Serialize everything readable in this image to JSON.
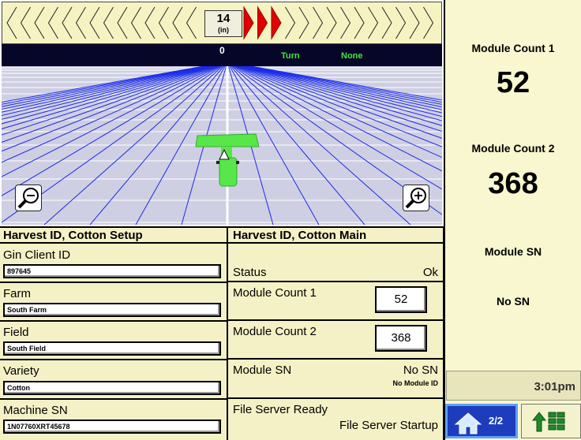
{
  "guidance": {
    "offset_value": "14",
    "offset_unit": "(in)",
    "cross_track": "0",
    "turn_label": "Turn",
    "turn_value": "None",
    "zoom_out_icon": "zoom-out-icon",
    "zoom_in_icon": "zoom-in-icon"
  },
  "right_panel": {
    "module_count_1_label": "Module Count 1",
    "module_count_1_value": "52",
    "module_count_2_label": "Module Count 2",
    "module_count_2_value": "368",
    "module_sn_label": "Module SN",
    "module_sn_value": "No SN",
    "time": "3:01pm",
    "page_indicator": "2/2",
    "home_icon": "home-icon",
    "menu_icon": "menu-grid-icon"
  },
  "setup_panel": {
    "title": "Harvest ID, Cotton Setup",
    "fields": [
      {
        "label": "Gin Client ID",
        "value": "897645"
      },
      {
        "label": "Farm",
        "value": "South Farm"
      },
      {
        "label": "Field",
        "value": "South Field"
      },
      {
        "label": "Variety",
        "value": "Cotton"
      },
      {
        "label": "Machine SN",
        "value": "1N07760XRT45678"
      }
    ]
  },
  "main_panel": {
    "title": "Harvest ID, Cotton Main",
    "status_label": "Status",
    "status_value": "Ok",
    "module_count_1_label": "Module Count 1",
    "module_count_1_value": "52",
    "module_count_2_label": "Module Count 2",
    "module_count_2_value": "368",
    "module_sn_label": "Module SN",
    "module_sn_value": "No SN",
    "module_id_value": "No Module ID",
    "file_server_line1": "File Server Ready",
    "file_server_line2": "File Server Startup"
  },
  "colors": {
    "panel_bg": "#f4f1c6",
    "right_bg": "#f9f7cf",
    "lightbar_active": "#e00000",
    "guidance_green": "#42e636",
    "nav_blue": "#1e3dbd"
  }
}
